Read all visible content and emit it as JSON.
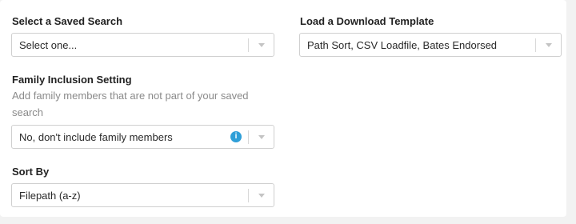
{
  "saved_search": {
    "label": "Select a Saved Search",
    "value": "Select one..."
  },
  "download_template": {
    "label": "Load a Download Template",
    "value": "Path Sort, CSV Loadfile, Bates Endorsed"
  },
  "family_inclusion": {
    "label": "Family Inclusion Setting",
    "help_line1": "Add family members that are not part of your saved",
    "help_line2": "search",
    "value": "No, don't include family members",
    "info_glyph": "i",
    "info_icon_color": "#2f9fd8"
  },
  "sort_by": {
    "label": "Sort By",
    "value": "Filepath (a-z)"
  }
}
